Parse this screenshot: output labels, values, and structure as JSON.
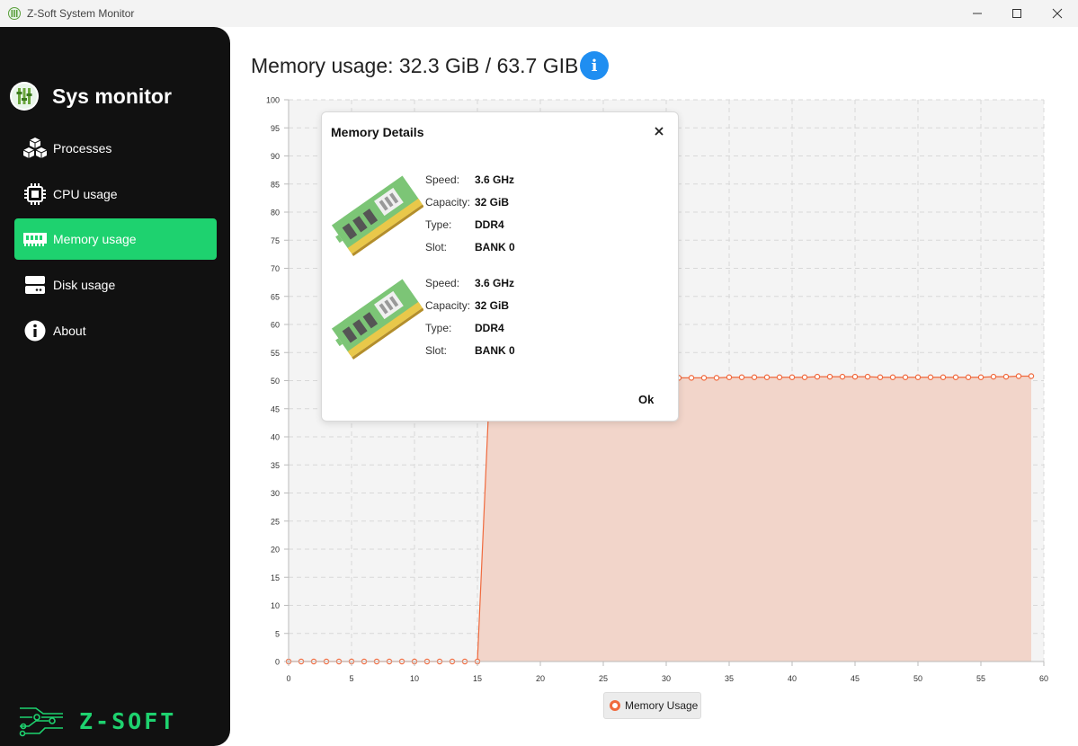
{
  "window": {
    "title": "Z-Soft System Monitor",
    "controls": {
      "minimize": "—",
      "maximize": "☐",
      "close": "✕"
    }
  },
  "sidebar": {
    "brand": "Sys monitor",
    "items": [
      {
        "label": "Processes",
        "icon": "cubes-icon",
        "active": false
      },
      {
        "label": "CPU usage",
        "icon": "cpu-icon",
        "active": false
      },
      {
        "label": "Memory usage",
        "icon": "memory-icon",
        "active": true
      },
      {
        "label": "Disk usage",
        "icon": "disk-icon",
        "active": false
      },
      {
        "label": "About",
        "icon": "info-icon",
        "active": false
      }
    ],
    "footer_logo": "Z-SOFT"
  },
  "main": {
    "title": "Memory usage: 32.3 GiB / 63.7 GIB",
    "info_button": "i"
  },
  "colors": {
    "accent": "#1ed26f",
    "series": "#f06a3e",
    "area": "#f2d5ca",
    "info": "#1f8ef1",
    "sidebar_bg": "#111111"
  },
  "chart_data": {
    "type": "area",
    "x": [
      0,
      1,
      2,
      3,
      4,
      5,
      6,
      7,
      8,
      9,
      10,
      11,
      12,
      13,
      14,
      15,
      16,
      17,
      18,
      19,
      20,
      21,
      22,
      23,
      24,
      25,
      26,
      27,
      28,
      29,
      30,
      31,
      32,
      33,
      34,
      35,
      36,
      37,
      38,
      39,
      40,
      41,
      42,
      43,
      44,
      45,
      46,
      47,
      48,
      49,
      50,
      51,
      52,
      53,
      54,
      55,
      56,
      57,
      58,
      59
    ],
    "series": [
      {
        "name": "Memory Usage",
        "values": [
          0,
          0,
          0,
          0,
          0,
          0,
          0,
          0,
          0,
          0,
          0,
          0,
          0,
          0,
          0,
          0,
          50.5,
          50.5,
          50.5,
          50.5,
          50.5,
          50.5,
          50.5,
          50.5,
          50.5,
          50.5,
          50.5,
          50.5,
          50.5,
          50.5,
          50.5,
          50.5,
          50.5,
          50.5,
          50.5,
          50.6,
          50.6,
          50.6,
          50.6,
          50.6,
          50.6,
          50.6,
          50.7,
          50.7,
          50.7,
          50.7,
          50.7,
          50.6,
          50.6,
          50.6,
          50.6,
          50.6,
          50.6,
          50.6,
          50.6,
          50.6,
          50.7,
          50.7,
          50.8,
          50.8
        ]
      }
    ],
    "xlim": [
      0,
      60
    ],
    "ylim": [
      0,
      100
    ],
    "xticks": [
      0,
      5,
      10,
      15,
      20,
      25,
      30,
      35,
      40,
      45,
      50,
      55,
      60
    ],
    "yticks": [
      0,
      5,
      10,
      15,
      20,
      25,
      30,
      35,
      40,
      45,
      50,
      55,
      60,
      65,
      70,
      75,
      80,
      85,
      90,
      95,
      100
    ],
    "grid": true,
    "legend": "bottom-center"
  },
  "dialog": {
    "title": "Memory Details",
    "close": "✕",
    "ok": "Ok",
    "labels": {
      "speed": "Speed:",
      "capacity": "Capacity:",
      "type": "Type:",
      "slot": "Slot:"
    },
    "modules": [
      {
        "speed": "3.6 GHz",
        "capacity": "32 GiB",
        "type": "DDR4",
        "slot": "BANK 0"
      },
      {
        "speed": "3.6 GHz",
        "capacity": "32 GiB",
        "type": "DDR4",
        "slot": "BANK 0"
      }
    ]
  }
}
